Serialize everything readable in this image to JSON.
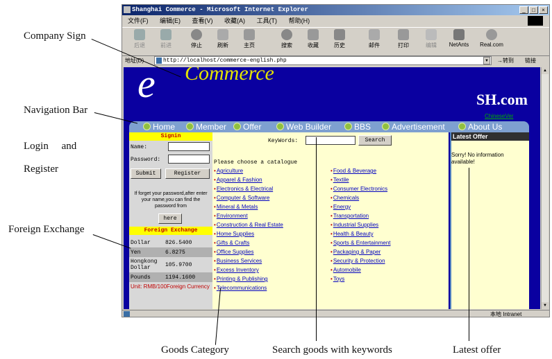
{
  "window": {
    "title": "Shanghai Commerce - Microsoft Internet Explorer",
    "minimize": "_",
    "maximize": "□",
    "close": "×"
  },
  "menu": [
    "文件(F)",
    "编辑(E)",
    "查看(V)",
    "收藏(A)",
    "工具(T)",
    "帮助(H)"
  ],
  "toolbar": {
    "back": "后退",
    "forward": "前进",
    "stop": "停止",
    "refresh": "刷新",
    "home": "主页",
    "search": "搜索",
    "favorites": "收藏",
    "history": "历史",
    "mail": "邮件",
    "print": "打印",
    "edit": "编辑",
    "netants": "NetAnts",
    "real": "Real.com"
  },
  "address": {
    "label": "地址(D)",
    "url": "http://localhost/commerce-english.php",
    "go": "转到",
    "links": "链接"
  },
  "site": {
    "logo_e": "e",
    "logo_commerce": "Commerce",
    "sh": "SH.com",
    "chinese_version": "ChineseVer"
  },
  "nav": [
    "Home",
    "Member",
    "Offer",
    "Web Builder",
    "BBS",
    "Advertisement",
    "About Us"
  ],
  "signin": {
    "title": "Signin",
    "name_label": "Name:",
    "password_label": "Password:",
    "submit": "Submit",
    "register": "Register",
    "forgot_text": "If forget your password,after enter your name,you can find the password from",
    "here": "here"
  },
  "fx": {
    "title": "Foreign Exchange",
    "rows": [
      {
        "name": "Dollar",
        "value": "826.5400"
      },
      {
        "name": "Yen",
        "value": "6.8275"
      },
      {
        "name": "Hongkong Dollar",
        "value": "105.9700"
      },
      {
        "name": "Pounds",
        "value": "1194.1600"
      }
    ],
    "unit": "Unit: RMB/100Foreign Currency"
  },
  "search": {
    "keywords_label": "KeyWords:",
    "button": "Search",
    "choose": "Please choose a catalogue"
  },
  "categories_left": [
    "Agriculture",
    "Apparel & Fashion",
    "Electronics & Electrical",
    "Computer & Software",
    "Mineral & Metals",
    "Environment",
    "Construction & Real Estate",
    "Home Supplies",
    "Gifts & Crafts",
    "Office Supplies",
    "Business Services",
    "Excess Inventory",
    "Printing & Publishing",
    "Telecommunications"
  ],
  "categories_right": [
    "Food & Beverage",
    "Textile",
    "Consumer Electronics",
    "Chemicals",
    "Energy",
    "Transportation",
    "Industrial Supplies",
    "Health & Beauty",
    "Sports & Entertainment",
    "Packaging & Paper",
    "Security & Protection",
    "Automobile",
    "Toys"
  ],
  "latest": {
    "title": "Latest Offer",
    "message": "Sorry! No information available!"
  },
  "status": {
    "zone": "本地 Intranet"
  },
  "annotations": {
    "company_sign": "Company Sign",
    "navigation_bar": "Navigation Bar",
    "login_and": "Login     and",
    "register": "Register",
    "foreign_exchange": "Foreign Exchange",
    "goods_category": "Goods Category",
    "search_goods": "Search goods with keywords",
    "latest_offer": "Latest offer"
  }
}
